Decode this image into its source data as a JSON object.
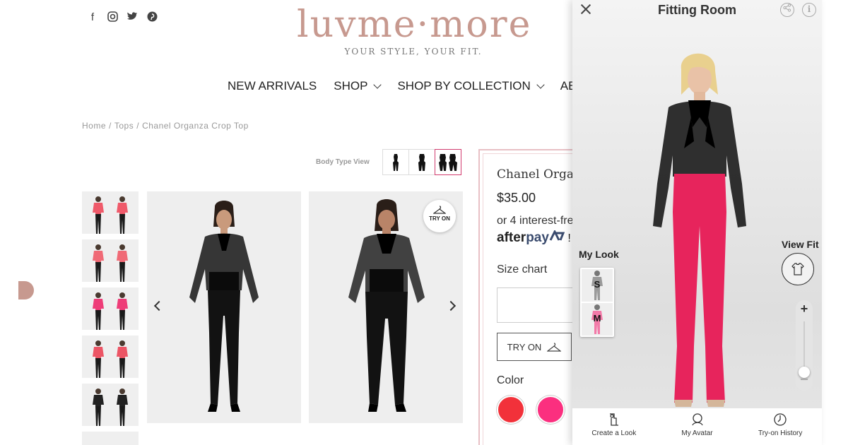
{
  "header": {
    "social_icons": [
      "facebook-icon",
      "instagram-icon",
      "twitter-icon",
      "pinterest-icon"
    ],
    "logo_text": "luvme·more",
    "tagline": "YOUR STYLE, YOUR FIT.",
    "brand_color": "#c7998f"
  },
  "nav": {
    "new_arrivals": "NEW ARRIVALS",
    "shop": "SHOP",
    "shop_by_collection": "SHOP BY COLLECTION",
    "about": "ABOU"
  },
  "breadcrumb": {
    "home": "Home",
    "sep": "/",
    "category": "Tops",
    "product": "Chanel Organza Crop Top"
  },
  "body_type": {
    "label": "Body Type View",
    "options": [
      "slim",
      "average",
      "curvy"
    ],
    "selected": "curvy"
  },
  "gallery": {
    "try_on_badge": "TRY ON",
    "thumbnail_count": 6
  },
  "product": {
    "title": "Chanel Organ",
    "price": "$35.00",
    "installments": "or 4 interest-fre",
    "afterpay_a": "after",
    "afterpay_b": "pay",
    "afterpay_tail": " !",
    "size_chart": "Size chart",
    "try_on": "TRY ON",
    "color_label": "Color",
    "colors": [
      "#f2313a",
      "#fb2f7f"
    ]
  },
  "fitting_room": {
    "title": "Fitting Room",
    "my_look_label": "My Look",
    "my_look_items": [
      {
        "size": "S",
        "color": "#9a9a9a"
      },
      {
        "size": "M",
        "color": "#f27aa8"
      }
    ],
    "view_fit_label": "View Fit",
    "zoom_plus": "+",
    "tabs": [
      "Create a Look",
      "My Avatar",
      "Try-on History"
    ],
    "top_color": "#151515",
    "pants_color": "#e7245c"
  }
}
